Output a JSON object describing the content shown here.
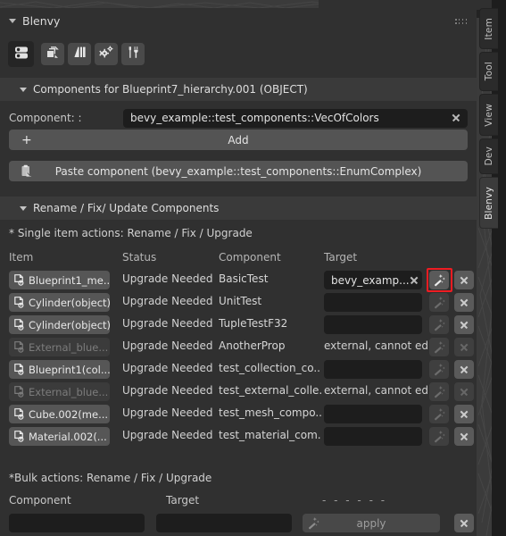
{
  "panel": {
    "title": "Blenvy",
    "grip_icon": "drag-grip-icon",
    "toolbar_icons": [
      {
        "name": "components-icon",
        "selected": true
      },
      {
        "name": "blueprints-icon",
        "selected": false
      },
      {
        "name": "levels-icon",
        "selected": false
      },
      {
        "name": "assets-icon",
        "selected": false
      },
      {
        "name": "settings-tools-icon",
        "selected": false
      }
    ]
  },
  "tabs": [
    {
      "label": "Item",
      "active": false
    },
    {
      "label": "Tool",
      "active": false
    },
    {
      "label": "View",
      "active": false
    },
    {
      "label": "Dev",
      "active": false
    },
    {
      "label": "Blenvy",
      "active": true
    }
  ],
  "components_section": {
    "header": "Components for Blueprint7_hierarchy.001 (OBJECT)",
    "component_label": "Component: :",
    "component_value": "bevy_example::test_components::VecOfColors",
    "clear_icon": "close-icon",
    "add_label": "Add",
    "add_icon": "plus-icon",
    "paste_label": "Paste component (bevy_example::test_components::EnumComplex)",
    "paste_icon": "clipboard-paste-icon"
  },
  "rename_section": {
    "header": "Rename / Fix/ Update Components",
    "single_note": "* Single item actions: Rename / Fix / Upgrade",
    "columns": [
      "Item",
      "Status",
      "Component",
      "Target"
    ],
    "rows": [
      {
        "item": "Blueprint1_me...",
        "status": "Upgrade Needed",
        "component": "BasicTest",
        "target_value": "bevy_examp...",
        "target_editable": true,
        "external": false,
        "wand_enabled": true,
        "delete_enabled": true,
        "highlighted": true
      },
      {
        "item": "Cylinder(object)",
        "status": "Upgrade Needed",
        "component": "UnitTest",
        "target_value": "",
        "target_editable": true,
        "external": false,
        "wand_enabled": false,
        "delete_enabled": true,
        "highlighted": false
      },
      {
        "item": "Cylinder(object)",
        "status": "Upgrade Needed",
        "component": "TupleTestF32",
        "target_value": "",
        "target_editable": true,
        "external": false,
        "wand_enabled": false,
        "delete_enabled": true,
        "highlighted": false
      },
      {
        "item": "External_blue...",
        "status": "Upgrade Needed",
        "component": "AnotherProp",
        "target_value": "external, cannot edit",
        "target_editable": false,
        "external": true,
        "wand_enabled": false,
        "delete_enabled": false,
        "highlighted": false
      },
      {
        "item": "Blueprint1(col...",
        "status": "Upgrade Needed",
        "component": "test_collection_co...",
        "target_value": "",
        "target_editable": true,
        "external": false,
        "wand_enabled": false,
        "delete_enabled": true,
        "highlighted": false
      },
      {
        "item": "External_blue...",
        "status": "Upgrade Needed",
        "component": "test_external_colle...",
        "target_value": "external, cannot edit",
        "target_editable": false,
        "external": true,
        "wand_enabled": false,
        "delete_enabled": false,
        "highlighted": false
      },
      {
        "item": "Cube.002(me...",
        "status": "Upgrade Needed",
        "component": "test_mesh_compo...",
        "target_value": "",
        "target_editable": true,
        "external": false,
        "wand_enabled": false,
        "delete_enabled": true,
        "highlighted": false
      },
      {
        "item": "Material.002(...",
        "status": "Upgrade Needed",
        "component": "test_material_com...",
        "target_value": "",
        "target_editable": true,
        "external": false,
        "wand_enabled": false,
        "delete_enabled": true,
        "highlighted": false
      }
    ],
    "row_item_icon": "component-item-icon",
    "wand_icon": "magic-wand-icon",
    "delete_icon": "close-icon"
  },
  "bulk_section": {
    "note": "*Bulk actions: Rename / Fix / Upgrade",
    "component_label": "Component",
    "target_label": "Target",
    "status_placeholder": "- - - - - -",
    "component_value": "",
    "target_value": "",
    "apply_label": "apply",
    "apply_icon": "magic-wand-icon",
    "clear_icon": "close-icon"
  },
  "colors": {
    "highlight": "#ee1c22",
    "panel_bg": "#303030",
    "subheader_bg": "#3a3a3a",
    "field_bg": "#1d1d1d",
    "button_bg": "#545454"
  }
}
